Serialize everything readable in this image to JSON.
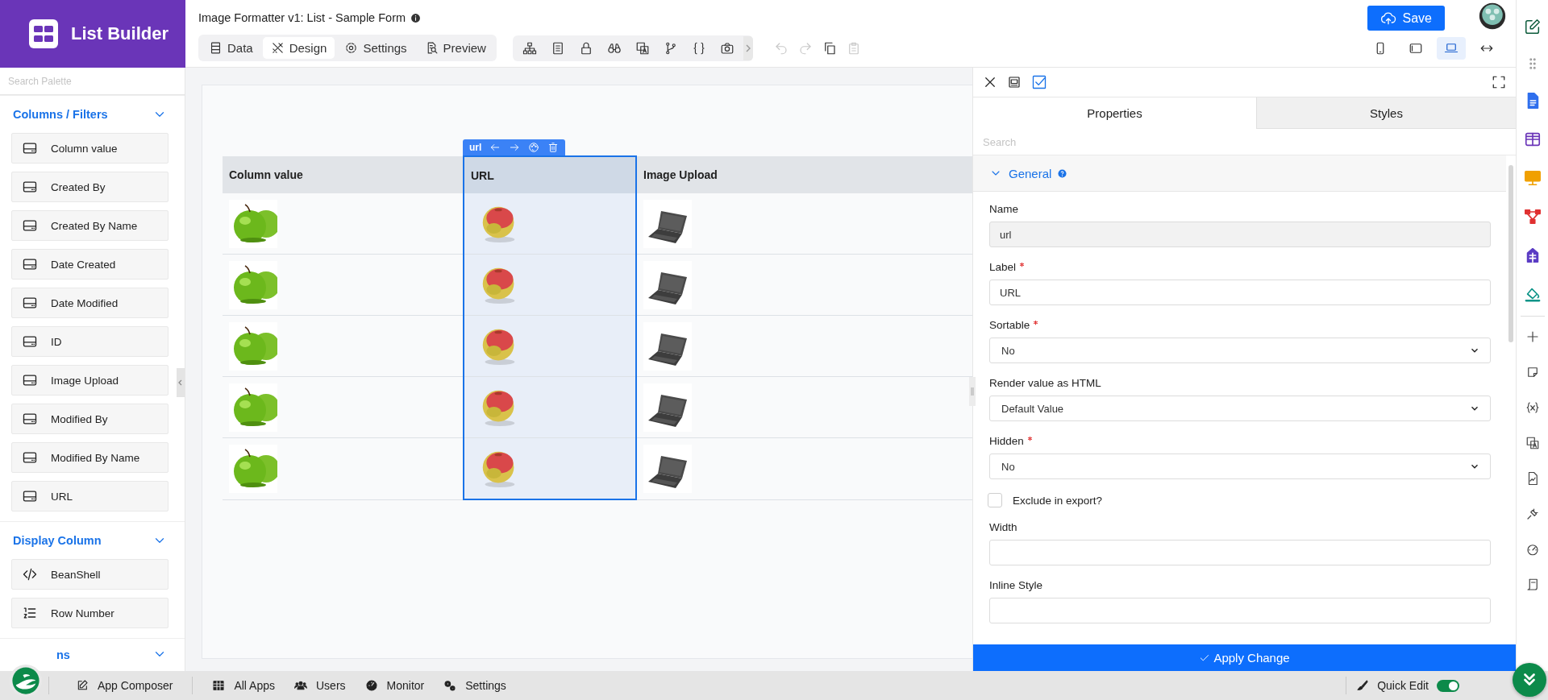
{
  "app": {
    "title": "List Builder"
  },
  "palette": {
    "search": {
      "placeholder": "Search Palette"
    },
    "sections": [
      {
        "title": "Columns / Filters",
        "expanded": true,
        "items": [
          {
            "label": "Column value",
            "kind": "column"
          },
          {
            "label": "Created By",
            "kind": "column"
          },
          {
            "label": "Created By Name",
            "kind": "column"
          },
          {
            "label": "Date Created",
            "kind": "column"
          },
          {
            "label": "Date Modified",
            "kind": "column"
          },
          {
            "label": "ID",
            "kind": "column"
          },
          {
            "label": "Image Upload",
            "kind": "column"
          },
          {
            "label": "Modified By",
            "kind": "column"
          },
          {
            "label": "Modified By Name",
            "kind": "column"
          },
          {
            "label": "URL",
            "kind": "column"
          }
        ]
      },
      {
        "title": "Display Column",
        "expanded": true,
        "items": [
          {
            "label": "BeanShell",
            "kind": "code"
          },
          {
            "label": "Row Number",
            "kind": "numbered"
          }
        ]
      },
      {
        "title": "ns",
        "expanded": true
      }
    ]
  },
  "document": {
    "title": "Image Formatter v1: List - Sample Form"
  },
  "mode_tabs": [
    {
      "label": "Data",
      "selected": false
    },
    {
      "label": "Design",
      "selected": true
    },
    {
      "label": "Settings",
      "selected": false
    },
    {
      "label": "Preview",
      "selected": false
    }
  ],
  "edit_tools": [
    {
      "kind": "undo",
      "disabled": true
    },
    {
      "kind": "redo",
      "disabled": true
    },
    {
      "kind": "copy",
      "disabled": false
    },
    {
      "kind": "paste",
      "disabled": true
    }
  ],
  "devices": [
    {
      "kind": "phone",
      "selected": false
    },
    {
      "kind": "tablet",
      "selected": false
    },
    {
      "kind": "laptop",
      "selected": true
    },
    {
      "kind": "full-width",
      "selected": false
    }
  ],
  "save_button": {
    "label": "Save"
  },
  "table": {
    "selection_toolbar": {
      "label": "url"
    },
    "columns": [
      {
        "label": "Column value",
        "selected": false
      },
      {
        "label": "URL",
        "selected": true
      },
      {
        "label": "Image Upload",
        "selected": false
      }
    ]
  },
  "properties": {
    "tabs": [
      {
        "label": "Properties",
        "selected": true
      },
      {
        "label": "Styles",
        "selected": false
      }
    ],
    "search": {
      "placeholder": "Search"
    },
    "section": {
      "title": "General",
      "expanded": true
    },
    "fields": [
      {
        "kind": "text",
        "label": "Name",
        "required": false,
        "value": "url",
        "disabled": true
      },
      {
        "kind": "text",
        "label": "Label",
        "required": true,
        "value": "URL",
        "disabled": false
      },
      {
        "kind": "select",
        "label": "Sortable",
        "required": true,
        "value": "No"
      },
      {
        "kind": "select",
        "label": "Render value as HTML",
        "required": false,
        "value": "Default Value"
      },
      {
        "kind": "select",
        "label": "Hidden",
        "required": true,
        "value": "No"
      },
      {
        "kind": "checkbox",
        "label": "Exclude in export?",
        "checked": false
      },
      {
        "kind": "text",
        "label": "Width",
        "required": false,
        "disabled": false
      },
      {
        "kind": "text",
        "label": "Inline Style",
        "required": false,
        "disabled": false
      }
    ],
    "apply_button": {
      "label": "Apply Change"
    }
  },
  "taskbar": {
    "items": [
      {
        "label": "App Composer",
        "kind": "composer"
      },
      {
        "label": "All Apps",
        "kind": "apps"
      },
      {
        "label": "Users",
        "kind": "users"
      },
      {
        "label": "Monitor",
        "kind": "monitor"
      },
      {
        "label": "Settings",
        "kind": "settings"
      }
    ],
    "quick_edit": {
      "label": "Quick Edit",
      "on": true
    }
  }
}
